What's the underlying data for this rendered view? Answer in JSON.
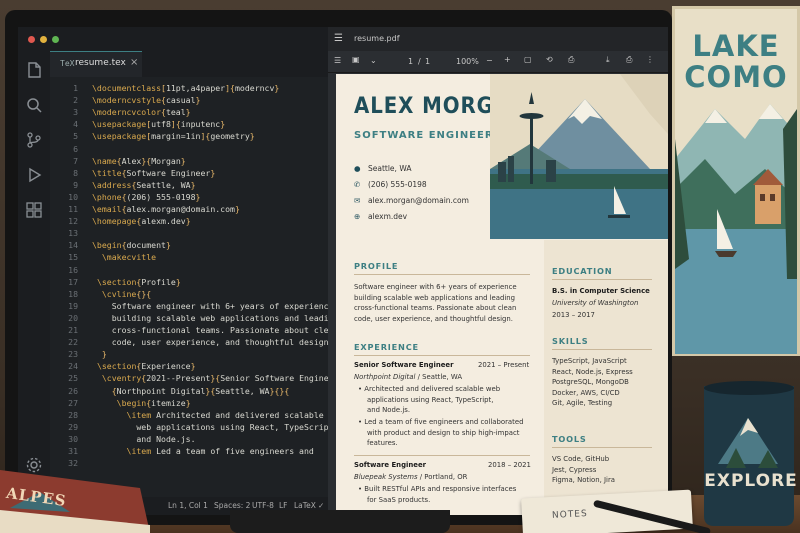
{
  "poster": {
    "title_line1": "LAKE",
    "title_line2": "COMO"
  },
  "mug": {
    "text": "EXPLORE"
  },
  "book": {
    "text": "ALPES"
  },
  "notes": {
    "text": "NOTES"
  },
  "editor": {
    "tab_icon": "TeX",
    "tab_name": "resume.tex",
    "tab_close": "×",
    "lines": [
      {
        "n": "1",
        "t": "\\documentclass[11pt,a4paper]{moderncv}"
      },
      {
        "n": "2",
        "t": "\\moderncvstyle{casual}"
      },
      {
        "n": "3",
        "t": "\\moderncvcolor{teal}"
      },
      {
        "n": "4",
        "t": "\\usepackage[utf8]{inputenc}"
      },
      {
        "n": "5",
        "t": "\\usepackage[margin=1in]{geometry}"
      },
      {
        "n": "6",
        "t": ""
      },
      {
        "n": "7",
        "t": "\\name{Alex}{Morgan}"
      },
      {
        "n": "8",
        "t": "\\title{Software Engineer}"
      },
      {
        "n": "9",
        "t": "\\address{Seattle, WA}"
      },
      {
        "n": "10",
        "t": "\\phone{(206) 555-0198}"
      },
      {
        "n": "11",
        "t": "\\email{alex.morgan@domain.com}"
      },
      {
        "n": "12",
        "t": "\\homepage{alexm.dev}"
      },
      {
        "n": "13",
        "t": ""
      },
      {
        "n": "14",
        "t": "\\begin{document}"
      },
      {
        "n": "15",
        "t": "  \\makecvitle"
      },
      {
        "n": "16",
        "t": ""
      },
      {
        "n": "17",
        "t": " \\section{Profile}"
      },
      {
        "n": "18",
        "t": "  \\cvline{}{"
      },
      {
        "n": "19",
        "t": "    Software engineer with 6+ years of experience"
      },
      {
        "n": "20",
        "t": "    building scalable web applications and leading"
      },
      {
        "n": "21",
        "t": "    cross-functional teams. Passionate about clean"
      },
      {
        "n": "22",
        "t": "    code, user experience, and thoughtful design."
      },
      {
        "n": "23",
        "t": "  }"
      },
      {
        "n": "24",
        "t": " \\section{Experience}"
      },
      {
        "n": "25",
        "t": "  \\cventry{2021--Present}{Senior Software Engineer}"
      },
      {
        "n": "26",
        "t": "    {Northpoint Digital}{Seattle, WA}{}{"
      },
      {
        "n": "27",
        "t": "     \\begin{itemize}"
      },
      {
        "n": "28",
        "t": "       \\item Architected and delivered scalable"
      },
      {
        "n": "29",
        "t": "         web applications using React, TypeScript,"
      },
      {
        "n": "30",
        "t": "         and Node.js."
      },
      {
        "n": "31",
        "t": "       \\item Led a team of five engineers and"
      },
      {
        "n": "32",
        "t": ""
      }
    ],
    "status": {
      "pos": "Ln 1, Col 1",
      "spaces": "Spaces: 2",
      "enc": "UTF-8",
      "eol": "LF",
      "lang": "LaTeX",
      "check": "✓"
    }
  },
  "pdf": {
    "file": "resume.pdf",
    "page_current": "1",
    "page_sep": "/",
    "page_total": "1",
    "zoom": "100%",
    "minus": "−",
    "plus": "+"
  },
  "resume": {
    "name": "ALEX MORGAN",
    "role": "SOFTWARE ENGINEER",
    "contact": {
      "city": "Seattle, WA",
      "phone": "(206) 555-0198",
      "email": "alex.morgan@domain.com",
      "web": "alexm.dev"
    },
    "profile_heading": "PROFILE",
    "profile_lines": [
      "Software engineer with 6+ years of experience",
      "building scalable web applications and leading",
      "cross-functional teams. Passionate about clean",
      "code, user experience, and thoughtful design."
    ],
    "experience_heading": "EXPERIENCE",
    "job1": {
      "title": "Senior Software Engineer",
      "dates": "2021 – Present",
      "company": "Northpoint Digital",
      "sep": "/",
      "place": "Seattle, WA",
      "b1": [
        "Architected and delivered scalable web",
        "applications using React, TypeScript,",
        "and Node.js."
      ],
      "b2": [
        "Led a team of five engineers and collaborated",
        "with product and design to ship high-impact",
        "features."
      ]
    },
    "job2": {
      "title": "Software Engineer",
      "dates": "2018 – 2021",
      "company": "Bluepeak Systems",
      "sep": "/",
      "place": "Portland, OR",
      "b1": [
        "Built RESTful APIs and responsive interfaces",
        "for SaaS products."
      ]
    },
    "education_heading": "EDUCATION",
    "edu": {
      "degree": "B.S. in Computer Science",
      "school": "University of Washington",
      "years": "2013 – 2017"
    },
    "skills_heading": "SKILLS",
    "skills": [
      "TypeScript, JavaScript",
      "React, Node.js, Express",
      "PostgreSQL, MongoDB",
      "Docker, AWS, CI/CD",
      "Git, Agile, Testing"
    ],
    "tools_heading": "TOOLS",
    "tools": [
      "VS Code, GitHub",
      "Jest, Cypress",
      "Figma, Notion, Jira"
    ]
  },
  "colors": {
    "accent": "#3d7f83",
    "name": "#1f4e5a",
    "paper": "#f4ede0"
  }
}
